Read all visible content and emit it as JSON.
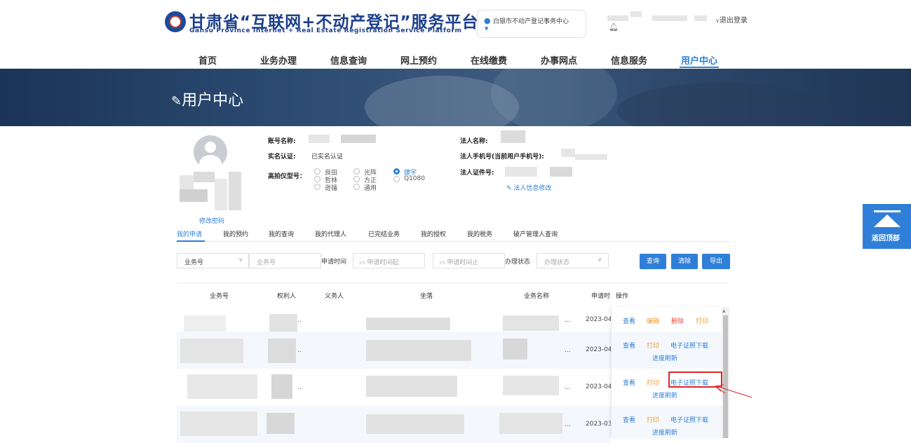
{
  "header": {
    "title": "甘肃省“互联网+不动产登记”服务平台",
    "subtitle": "Gansu Province Internet + Real Estate Registration Service Platform",
    "location": "白银市不动产登记事务中心",
    "logout": "退出登录"
  },
  "nav": {
    "items": [
      "首页",
      "业务办理",
      "信息查询",
      "网上预约",
      "在线缴费",
      "办事网点",
      "信息服务",
      "用户中心"
    ],
    "active": "用户中心"
  },
  "banner": {
    "title": "用户中心"
  },
  "profile": {
    "change_password": "修改密码",
    "account_label": "账号名称:",
    "realname_label": "实名认证:",
    "realname_value": "已实名认证",
    "camera_label": "高拍仪型号：",
    "camera_options": [
      "良田",
      "哲林",
      "逊镭",
      "光阵",
      "方正",
      "通用",
      "捷宇",
      "Q1080"
    ],
    "camera_selected": "捷宇",
    "legal_name_label": "法人名称:",
    "legal_phone_label": "法人手机号(当前用户手机号):",
    "legal_id_label": "法人证件号:",
    "legal_edit": "法人信息修改"
  },
  "tabs": {
    "items": [
      "我的申请",
      "我的预约",
      "我的查询",
      "我的代理人",
      "已完结业务",
      "我的授权",
      "我的税务",
      "破产管理人查询"
    ],
    "active": "我的申请"
  },
  "search": {
    "type_select": "业务号",
    "number_placeholder": "业务号",
    "time_label": "申请时间",
    "start_placeholder": "申请时间起",
    "end_placeholder": "申请时间止",
    "status_label": "办理状态",
    "status_placeholder": "办理状态",
    "query_btn": "查询",
    "clear_btn": "清除",
    "export_btn": "导出"
  },
  "table": {
    "headers": [
      "业务号",
      "权利人",
      "义务人",
      "坐落",
      "业务名称",
      "申请时",
      "操作"
    ],
    "rows": [
      {
        "date": "2023-04",
        "ops": [
          {
            "label": "查看",
            "color": "blue"
          },
          {
            "label": "编辑",
            "color": "orange"
          },
          {
            "label": "删除",
            "color": "red"
          },
          {
            "label": "打印",
            "color": "orange"
          }
        ]
      },
      {
        "date": "2023-04",
        "ops": [
          {
            "label": "查看",
            "color": "blue"
          },
          {
            "label": "打印",
            "color": "orange"
          },
          {
            "label": "电子证照下载",
            "color": "blue"
          },
          {
            "label": "进度刷新",
            "color": "blue"
          }
        ]
      },
      {
        "date": "2023-04",
        "ops": [
          {
            "label": "查看",
            "color": "blue"
          },
          {
            "label": "打印",
            "color": "orange"
          },
          {
            "label": "电子证照下载",
            "color": "blue"
          },
          {
            "label": "进度刷新",
            "color": "blue"
          }
        ]
      },
      {
        "date": "2023-03",
        "ops": [
          {
            "label": "查看",
            "color": "blue"
          },
          {
            "label": "打印",
            "color": "orange"
          },
          {
            "label": "电子证照下载",
            "color": "blue"
          },
          {
            "label": "进度刷新",
            "color": "blue"
          }
        ]
      }
    ]
  },
  "back_to_top": "返回顶部",
  "colors": {
    "primary": "#2f7fd8",
    "brand": "#1b3f8b",
    "highlight": "#d9262c",
    "orange": "#f09a2c",
    "red": "#e74c3c"
  },
  "icons": [
    "location-pin-icon",
    "bell-icon",
    "edit-icon",
    "avatar-icon",
    "calendar-icon",
    "chevron-down-icon",
    "arrow-up-icon"
  ]
}
